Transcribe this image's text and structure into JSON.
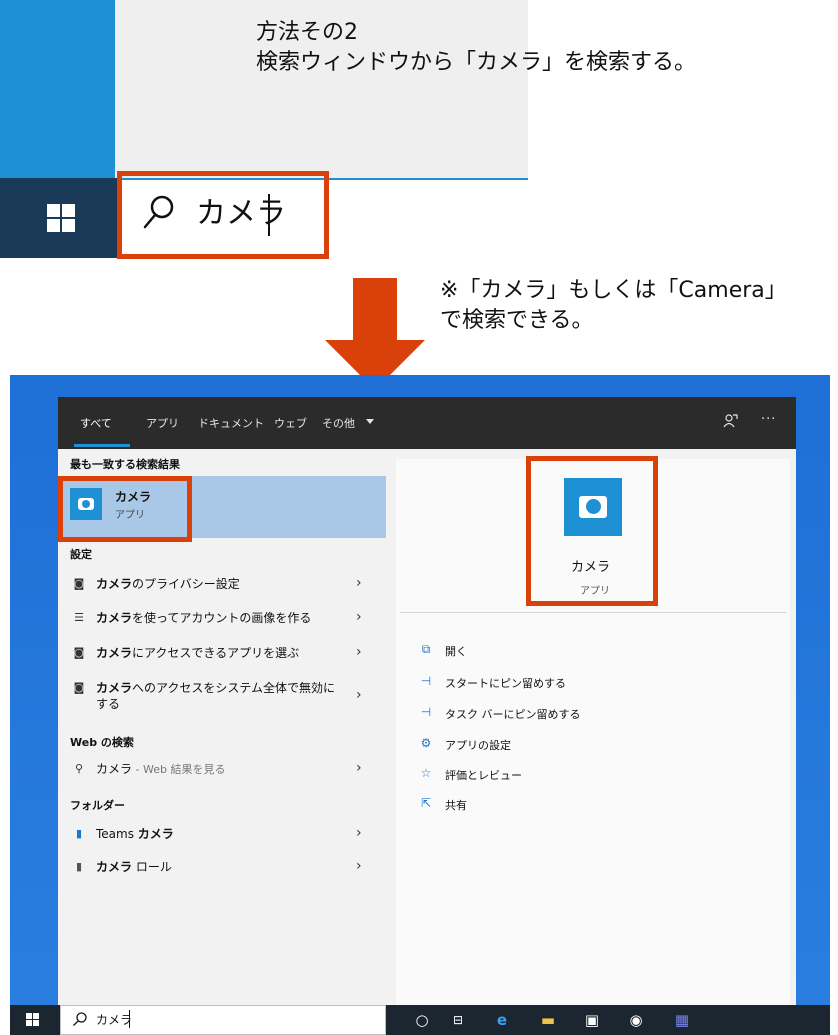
{
  "header": {
    "method_line1": "方法その2",
    "method_line2": "検索ウィンドウから「カメラ」を検索する。",
    "search_query": "カメラ",
    "note_line1": "※「カメラ」もしくは「Camera」",
    "note_line2": "で検索できる。"
  },
  "tabs": [
    {
      "label": "すべて"
    },
    {
      "label": "アプリ"
    },
    {
      "label": "ドキュメント"
    },
    {
      "label": "ウェブ"
    },
    {
      "label": "その他"
    }
  ],
  "more_label": "···",
  "best_match": {
    "heading": "最も一致する検索結果",
    "name": "カメラ",
    "type": "アプリ"
  },
  "settings": {
    "heading": "設定",
    "items": [
      {
        "bold": "カメラ",
        "rest": "のプライバシー設定",
        "icon": "camera-frame-icon"
      },
      {
        "bold": "カメラ",
        "rest": "を使ってアカウントの画像を作る",
        "icon": "account-list-icon"
      },
      {
        "bold": "カメラ",
        "rest": "にアクセスできるアプリを選ぶ",
        "icon": "camera-frame-icon"
      },
      {
        "bold": "カメラ",
        "rest": "へのアクセスをシステム全体で無効に",
        "rest2": "する",
        "icon": "camera-frame-icon"
      }
    ]
  },
  "web": {
    "heading": "Web の検索",
    "item_bold": "カメラ",
    "item_rest": " - Web 結果を見る"
  },
  "folders": {
    "heading": "フォルダー",
    "items": [
      {
        "prefix": "Teams ",
        "bold": "カメラ",
        "rest": ""
      },
      {
        "prefix": "",
        "bold": "カメラ",
        "rest": " ロール"
      }
    ]
  },
  "detail": {
    "name": "カメラ",
    "type": "アプリ",
    "actions": [
      {
        "label": "開く",
        "icon": "open-icon"
      },
      {
        "label": "スタートにピン留めする",
        "icon": "pin-icon"
      },
      {
        "label": "タスク バーにピン留めする",
        "icon": "pin-icon"
      },
      {
        "label": "アプリの設定",
        "icon": "gear-icon"
      },
      {
        "label": "評価とレビュー",
        "icon": "star-list-icon"
      },
      {
        "label": "共有",
        "icon": "share-icon"
      }
    ]
  },
  "taskbar": {
    "search_text": "カメラ"
  },
  "colors": {
    "highlight": "#d9400a",
    "accent": "#1e90d4",
    "selection": "#a9c8e8"
  }
}
